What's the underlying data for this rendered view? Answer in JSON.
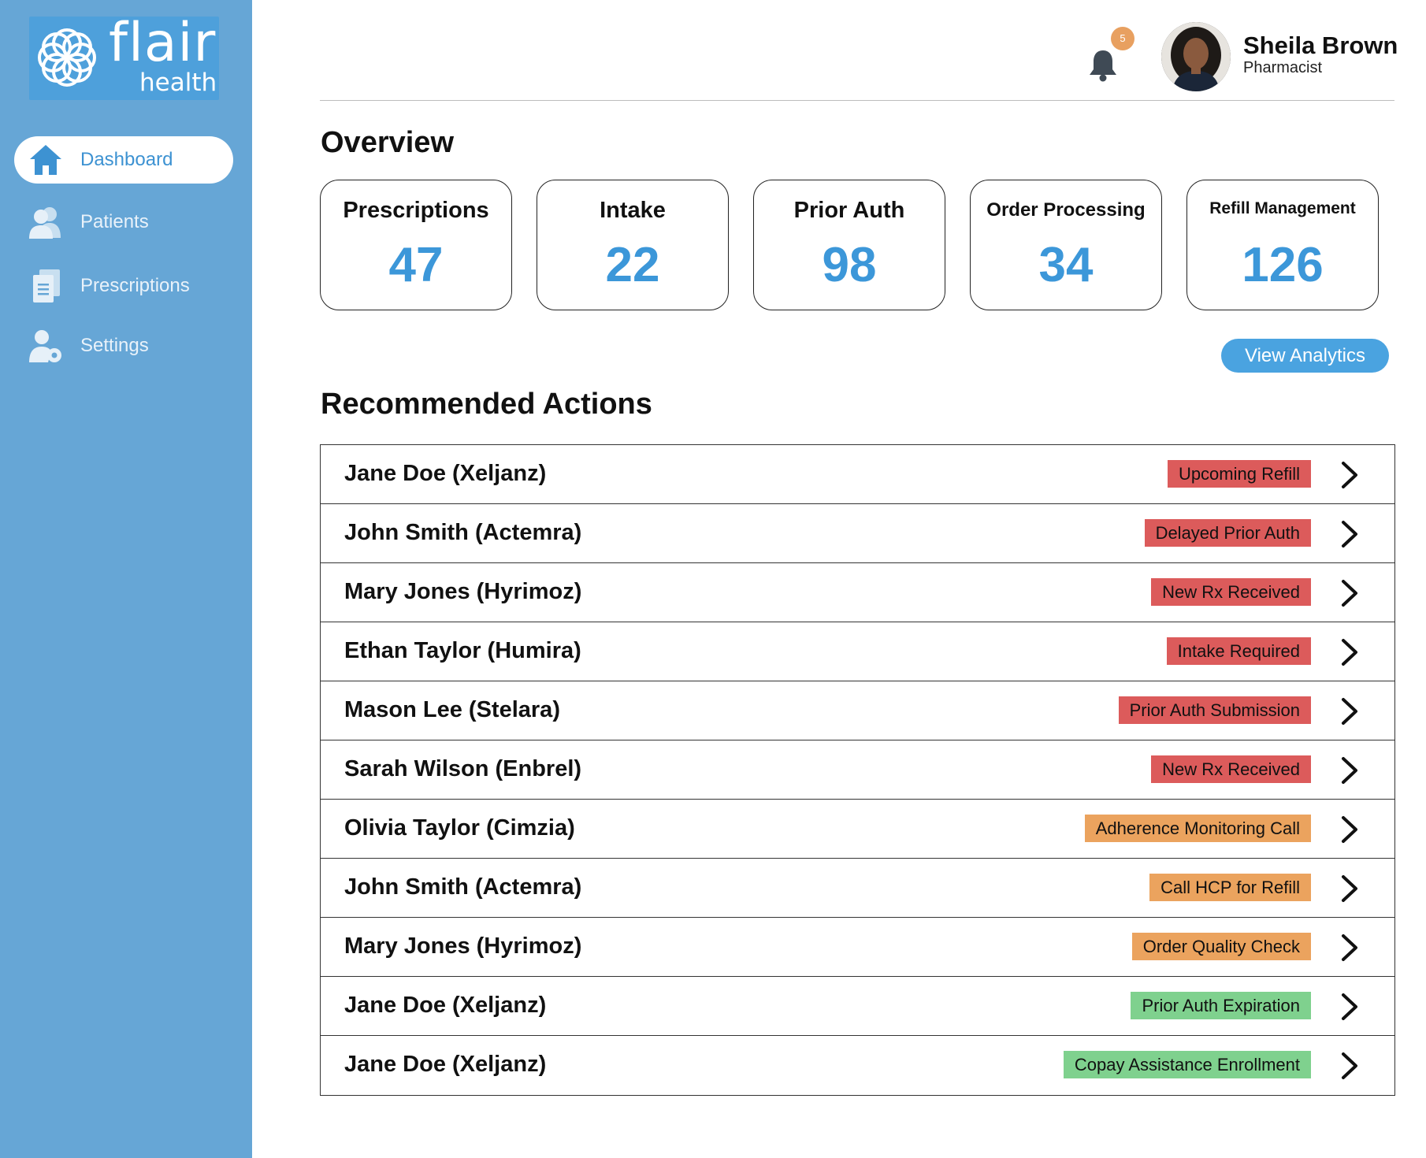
{
  "brand": {
    "name": "flair",
    "tagline": "health",
    "color": "#4ea0db"
  },
  "sidebar": {
    "items": [
      {
        "label": "Dashboard",
        "icon": "home-icon",
        "active": true
      },
      {
        "label": "Patients",
        "icon": "users-icon",
        "active": false
      },
      {
        "label": "Prescriptions",
        "icon": "document-icon",
        "active": false
      },
      {
        "label": "Settings",
        "icon": "user-gear-icon",
        "active": false
      }
    ]
  },
  "header": {
    "notification_count": "5",
    "user": {
      "name": "Sheila Brown",
      "role": "Pharmacist"
    }
  },
  "overview": {
    "title": "Overview",
    "cards": [
      {
        "title": "Prescriptions",
        "value": "47"
      },
      {
        "title": "Intake",
        "value": "22"
      },
      {
        "title": "Prior Auth",
        "value": "98"
      },
      {
        "title": "Order Processing",
        "value": "34"
      },
      {
        "title": "Refill Management",
        "value": "126"
      }
    ],
    "analytics_button": "View Analytics"
  },
  "actions": {
    "title": "Recommended Actions",
    "rows": [
      {
        "patient": "Jane Doe (Xeljanz)",
        "tag": "Upcoming Refill",
        "tag_color": "#dc5b5b"
      },
      {
        "patient": "John Smith (Actemra)",
        "tag": "Delayed Prior Auth",
        "tag_color": "#dc5b5b"
      },
      {
        "patient": "Mary Jones (Hyrimoz)",
        "tag": "New Rx Received",
        "tag_color": "#dc5b5b"
      },
      {
        "patient": "Ethan Taylor (Humira)",
        "tag": "Intake Required",
        "tag_color": "#dc5b5b"
      },
      {
        "patient": "Mason Lee (Stelara)",
        "tag": "Prior Auth Submission",
        "tag_color": "#dc5b5b"
      },
      {
        "patient": "Sarah Wilson (Enbrel)",
        "tag": "New Rx Received",
        "tag_color": "#dc5b5b"
      },
      {
        "patient": "Olivia Taylor (Cimzia)",
        "tag": "Adherence Monitoring Call",
        "tag_color": "#eba35e"
      },
      {
        "patient": "John Smith (Actemra)",
        "tag": "Call HCP for Refill",
        "tag_color": "#eba35e"
      },
      {
        "patient": "Mary Jones (Hyrimoz)",
        "tag": "Order Quality Check",
        "tag_color": "#eba35e"
      },
      {
        "patient": "Jane Doe (Xeljanz)",
        "tag": "Prior Auth Expiration",
        "tag_color": "#7fd18e"
      },
      {
        "patient": "Jane Doe (Xeljanz)",
        "tag": "Copay Assistance Enrollment",
        "tag_color": "#7fd18e"
      }
    ]
  },
  "colors": {
    "sidebar": "#66a6d6",
    "accent": "#3c97d9",
    "urgent": "#dc5b5b",
    "warning": "#eba35e",
    "ok": "#7fd18e",
    "badge": "#e8a060"
  }
}
